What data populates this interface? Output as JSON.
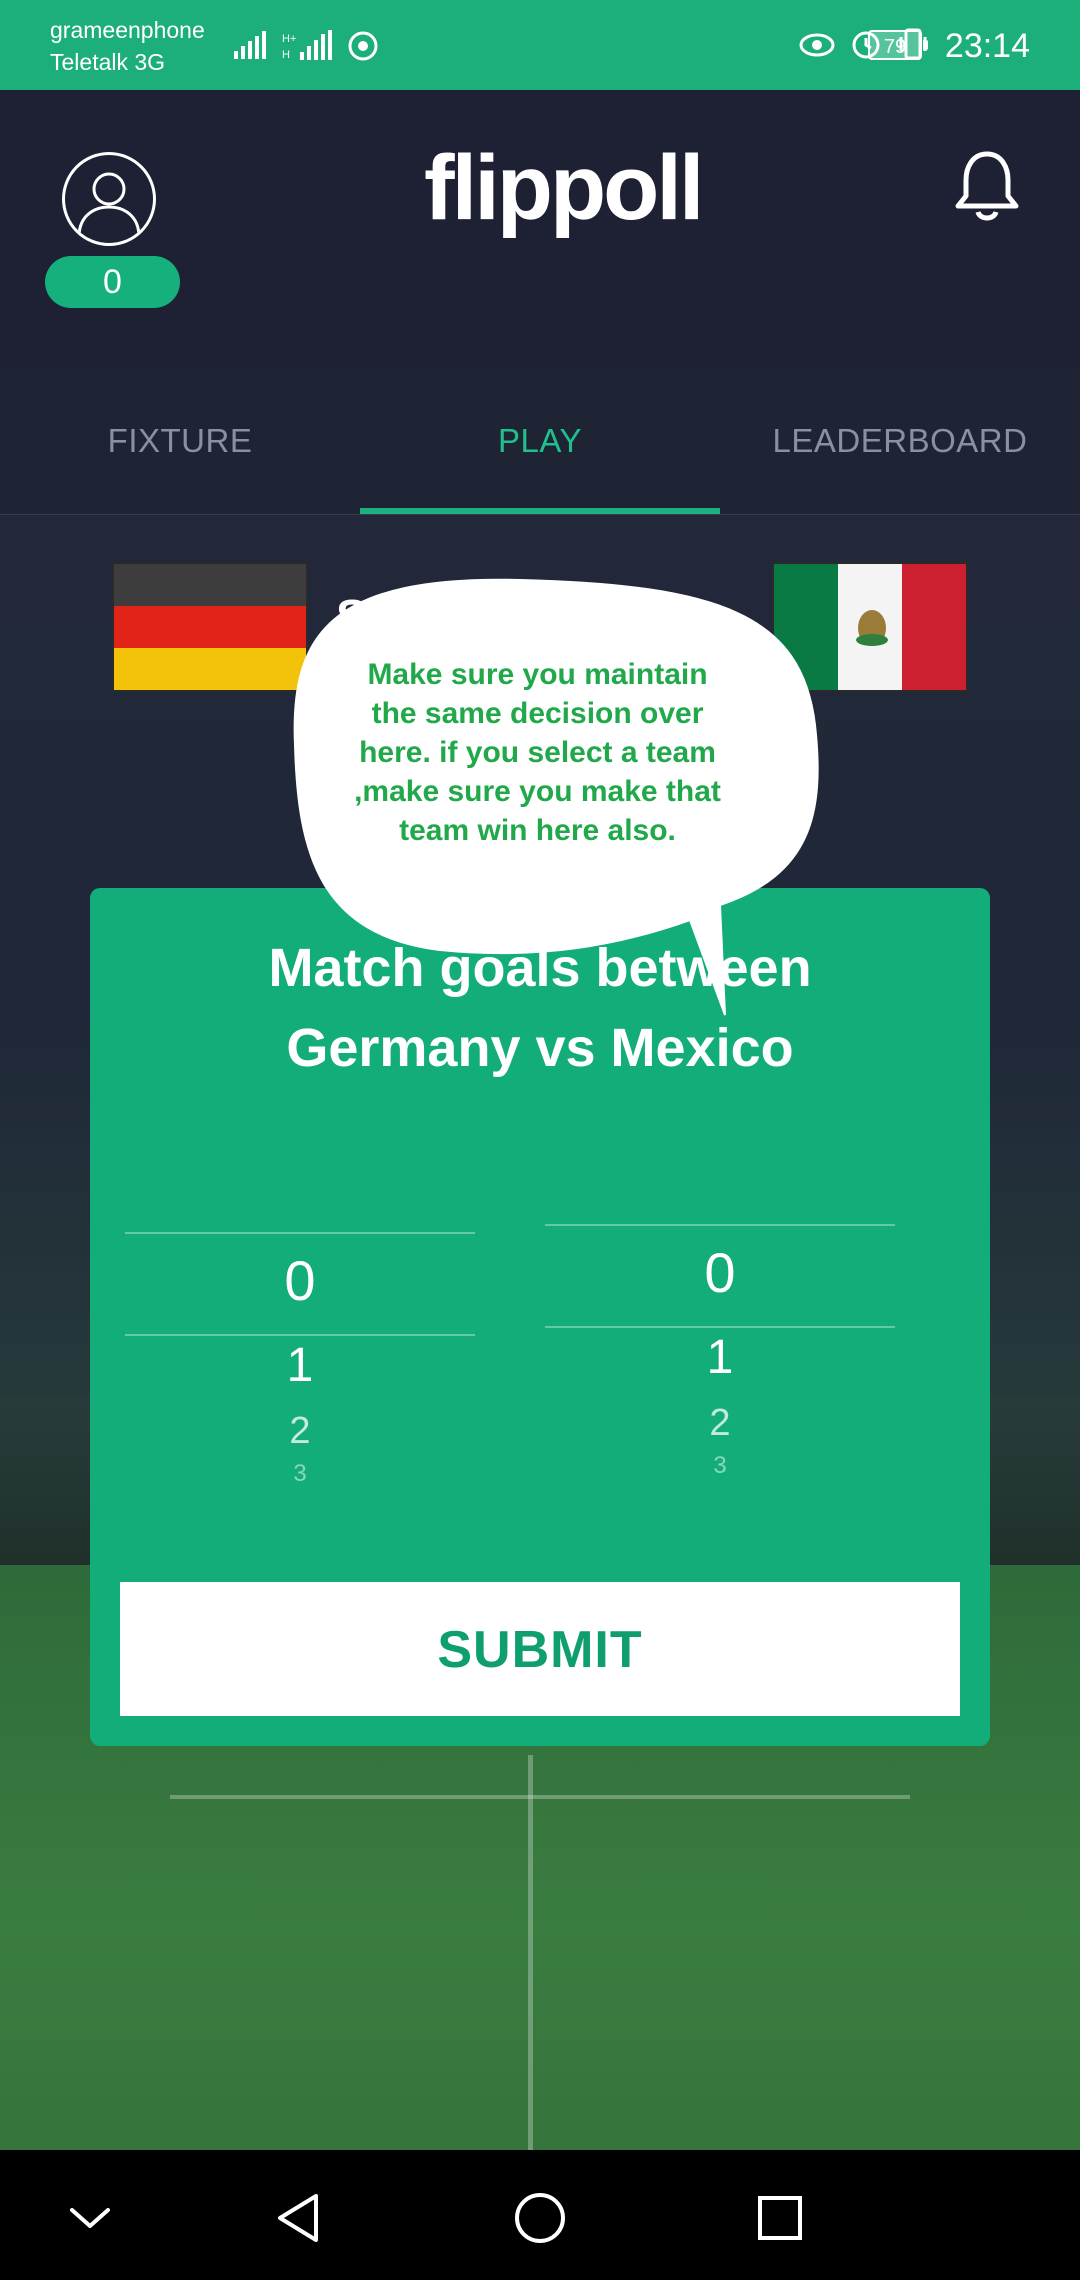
{
  "status_bar": {
    "carrier_line1": "grameenphone",
    "carrier_line2": "Teletalk 3G",
    "battery": "79",
    "time": "23:14",
    "icons_left": [
      "signal-icon",
      "network-signal-icon",
      "chrome-icon"
    ],
    "icons_right": [
      "eye-icon",
      "alarm-icon",
      "vibrate-icon",
      "battery-icon"
    ]
  },
  "header": {
    "logo": "flippoll",
    "points": "0"
  },
  "tabs": [
    {
      "label": "FIXTURE"
    },
    {
      "label": "PLAY"
    },
    {
      "label": "LEADERBOARD"
    }
  ],
  "active_tab": "PLAY",
  "card": {
    "title_line1": "Match goals between",
    "title_line2": "Germany vs Mexico",
    "left_picker": [
      "0",
      "1",
      "2",
      "3"
    ],
    "right_picker": [
      "0",
      "1",
      "2",
      "3"
    ],
    "submit_label": "SUBMIT"
  },
  "bubble": {
    "text": "Make sure you maintain the same decision over here. if you select a team ,make sure you make that team win here also."
  },
  "partial_text": "S",
  "colors": {
    "accent": "#1caf7a",
    "card": "#12ad79",
    "header_bg": "#1d2133",
    "bubble_text": "#21a84a"
  }
}
